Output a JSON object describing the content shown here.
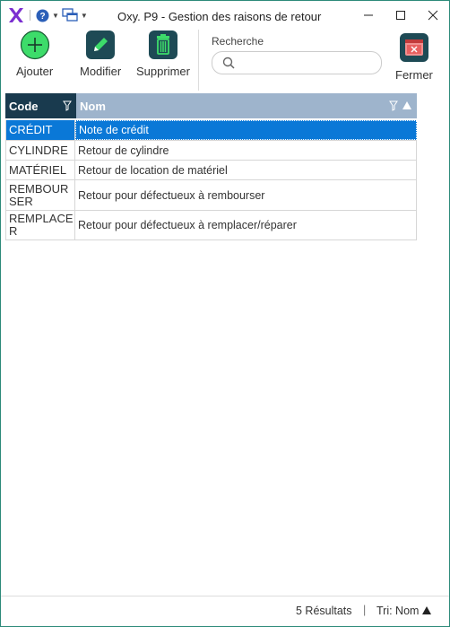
{
  "window": {
    "title": "Oxy. P9 - Gestion des raisons de retour"
  },
  "toolbar": {
    "add_label": "Ajouter",
    "edit_label": "Modifier",
    "delete_label": "Supprimer",
    "close_label": "Fermer",
    "search_label": "Recherche",
    "search_value": ""
  },
  "grid": {
    "columns": {
      "code": "Code",
      "nom": "Nom"
    },
    "rows": [
      {
        "code": "CRÉDIT",
        "nom": "Note de crédit",
        "selected": true
      },
      {
        "code": "CYLINDRE",
        "nom": "Retour de cylindre"
      },
      {
        "code": "MATÉRIEL",
        "nom": "Retour de location de matériel"
      },
      {
        "code": "REMBOURSER",
        "nom": "Retour pour défectueux à rembourser"
      },
      {
        "code": "REMPLACER",
        "nom": "Retour pour défectueux à remplacer/réparer"
      }
    ]
  },
  "status": {
    "results": "5 Résultats",
    "separator": "|",
    "sort": "Tri: Nom"
  },
  "colors": {
    "accent": "#0a78d7",
    "header_dark": "#193a4e",
    "header_light": "#9eb4cc",
    "add_green": "#3ddc6a",
    "tool_dark": "#1e4a55",
    "close_red": "#c23b3b"
  }
}
